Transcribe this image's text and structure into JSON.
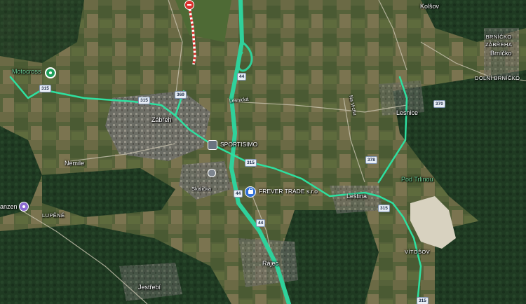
{
  "map": {
    "style": "satellite",
    "colors": {
      "route": "#2ee0a0",
      "highway": "#2fd19b",
      "closure_red": "#d9302c",
      "shop_blue": "#2f6fd8",
      "label_green": "#6fd39a"
    }
  },
  "places": {
    "kolsov": "Kolšov",
    "brnicko_zabreha": "BRNÍČKO\nZÁBŘEHA",
    "brnicko": "Brníčko",
    "dolni_brnicko": "DOLNÍ BRNÍČKO",
    "motocross": "Motocross",
    "zabreh": "Zábřeh",
    "lesnicka": "Lesnická",
    "lesnice": "Lesnice",
    "nemile": "Nemile",
    "skalicka": "Skalička",
    "pod_trlinou": "Pod Trlinou",
    "lestina": "Leština",
    "anzen": "anzen",
    "lupene": "LUPĚNÉ",
    "vitosov": "VÍTOŠOV",
    "rajec": "Rájec",
    "jestrebi": "Jestřebí",
    "street_vertical": "Na Vrchu"
  },
  "pois": {
    "sportisimo": "SPORTISIMO",
    "frever": "FREVER TRADE s.r.o",
    "motocross_icon": "motocross-icon",
    "shop_icon": "shopping-bag-icon",
    "store_icon": "store-icon",
    "closure_icon": "road-closed-icon"
  },
  "shields": {
    "r315_a": "315",
    "r315_b": "315",
    "r315_c": "315",
    "r315_d": "315",
    "r315_e": "315",
    "r369": "369",
    "r44_a": "44",
    "r44_b": "44",
    "r44_c": "44",
    "r378": "378",
    "r370": "370"
  }
}
